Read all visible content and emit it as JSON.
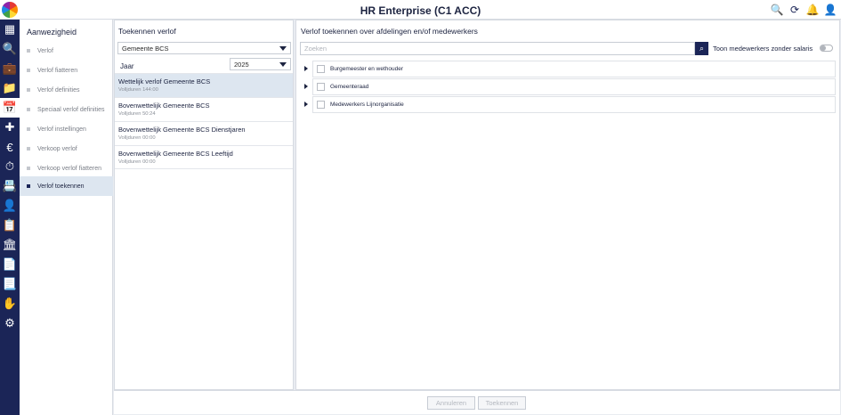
{
  "app": {
    "title": "HR Enterprise (C1 ACC)"
  },
  "topbar_icons": [
    "search-person-icon",
    "refresh-screen-icon",
    "notification-bell-icon",
    "user-icon"
  ],
  "colors": {
    "accent": "#1b2557",
    "active_icon": "#c2185b",
    "selected_row": "#dde6f0",
    "alert": "#e74c3c"
  },
  "sidebar_icons": [
    "dashboard-icon",
    "search-icon",
    "briefcase-icon",
    "folder-icon",
    "calendar-icon",
    "medical-kit-icon",
    "money-bag-icon",
    "stopwatch-icon",
    "id-card-icon",
    "person-icon",
    "badge-icon",
    "building-icon",
    "document-icon",
    "document-list-icon",
    "hand-money-icon",
    "gear-icon"
  ],
  "nav": {
    "title": "Aanwezigheid",
    "items": [
      {
        "label": "Verlof"
      },
      {
        "label": "Verlof fiatteren"
      },
      {
        "label": "Verlof definities"
      },
      {
        "label": "Speciaal verlof definities"
      },
      {
        "label": "Verlof instellingen"
      },
      {
        "label": "Verkoop verlof"
      },
      {
        "label": "Verkoop verlof fiatteren"
      },
      {
        "label": "Verlof toekennen"
      }
    ],
    "active_index": 7
  },
  "middle": {
    "title": "Toekennen verlof",
    "organization_select": "Gemeente BCS",
    "year_label": "Jaar",
    "year_value": "2025",
    "items": [
      {
        "title": "Wettelijk verlof Gemeente BCS",
        "subtitle": "Volljduren 144:00"
      },
      {
        "title": "Bovenwettelijk Gemeente BCS",
        "subtitle": "Volljduren 50:24"
      },
      {
        "title": "Bovenwettelijk Gemeente BCS Dienstjaren",
        "subtitle": "Volljduren 00:00"
      },
      {
        "title": "Bovenwettelijk Gemeente BCS Leeftijd",
        "subtitle": "Volljduren 00:00"
      }
    ],
    "selected_index": 0
  },
  "right": {
    "title": "Verlof toekennen over afdelingen en/of medewerkers",
    "search_placeholder": "Zoeken",
    "toggle_label": "Toon medewerkers zonder salaris",
    "toggle_on": false,
    "tree": [
      {
        "label": "Burgemeester en wethouder"
      },
      {
        "label": "Gemeenteraad"
      },
      {
        "label": "Medewerkers Lijnorganisatie"
      }
    ]
  },
  "footer": {
    "cancel_label": "Annuleren",
    "grant_label": "Toekennen"
  }
}
